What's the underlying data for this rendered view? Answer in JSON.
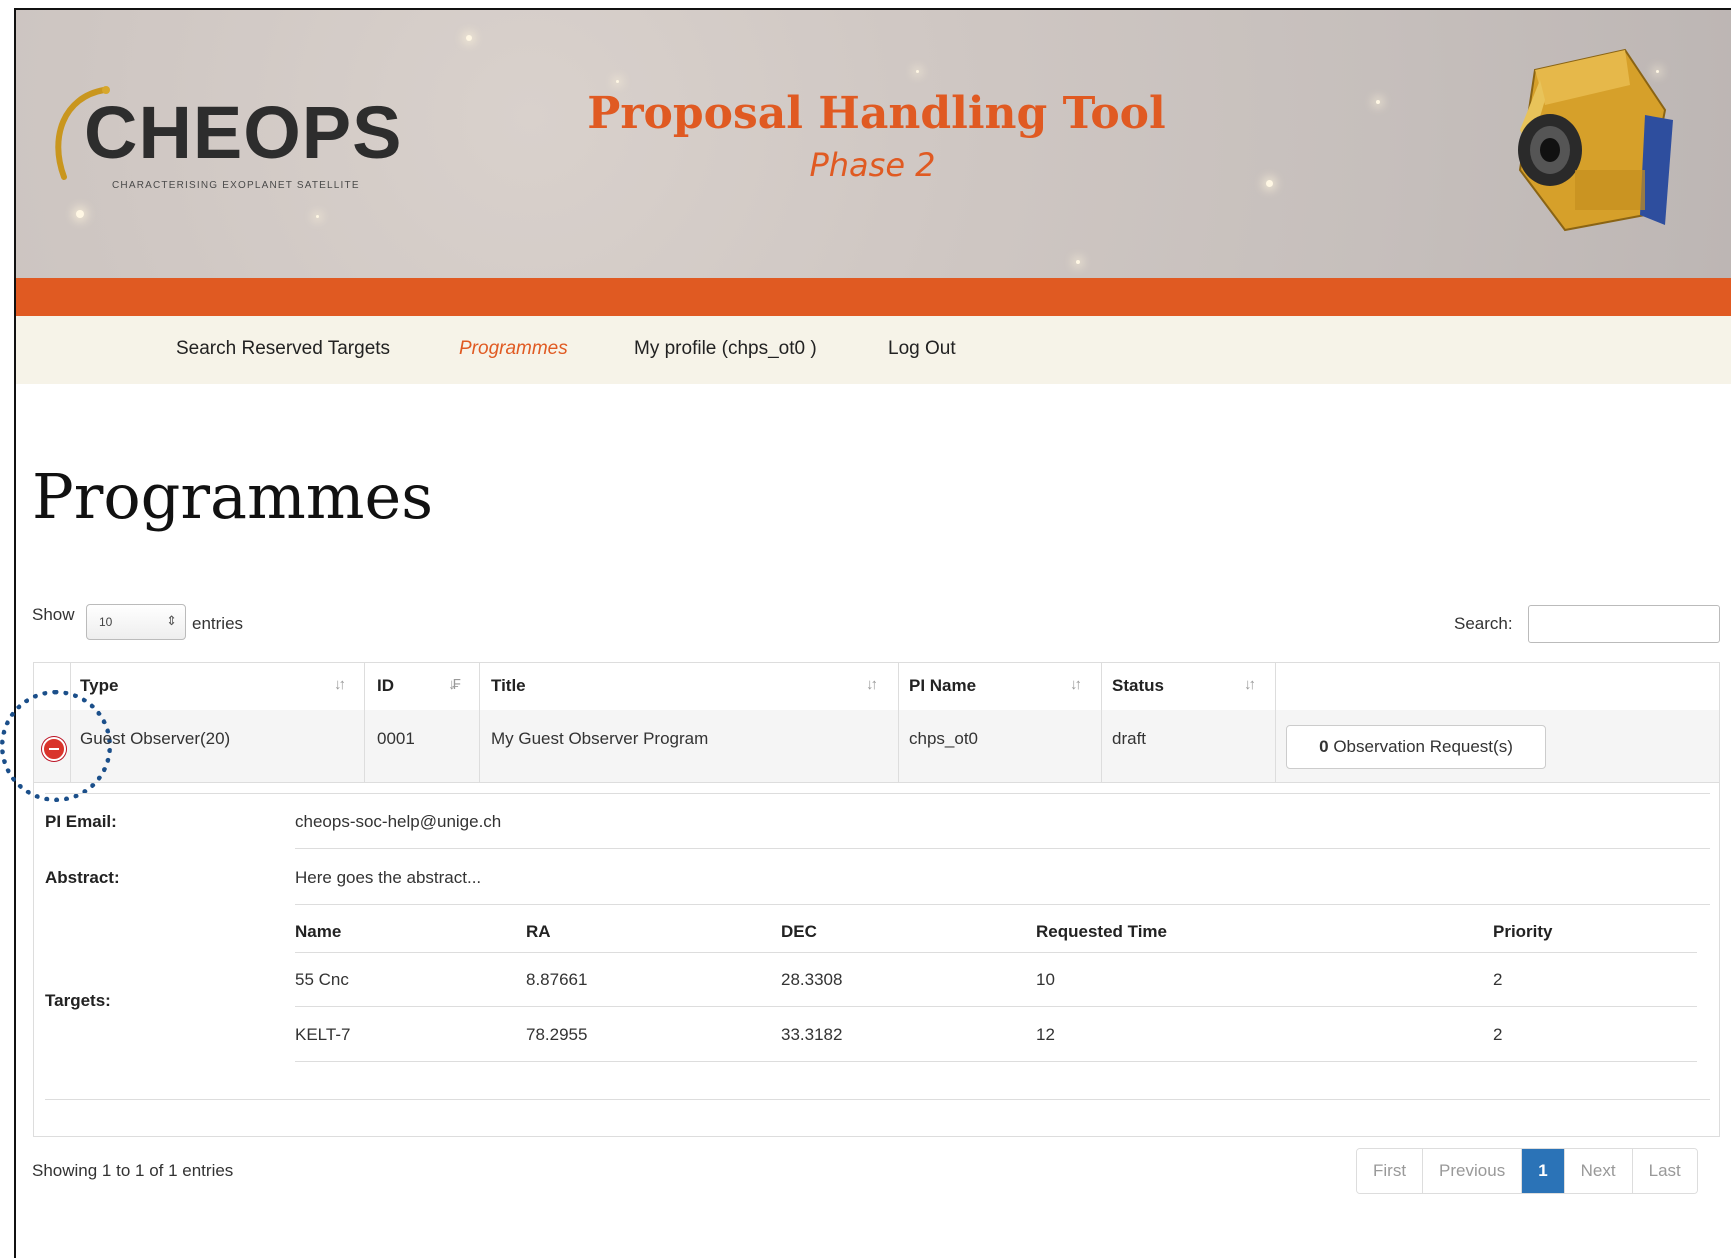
{
  "header": {
    "logo_text": "CHEOPS",
    "logo_subtitle": "CHARACTERISING EXOPLANET SATELLITE",
    "app_title": "Proposal Handling Tool",
    "app_subtitle": "Phase 2",
    "accent_color": "#e05a22"
  },
  "nav": {
    "items": [
      {
        "label": "Search Reserved Targets"
      },
      {
        "label": "Programmes"
      },
      {
        "label": "My profile (chps_ot0 )"
      },
      {
        "label": "Log Out"
      }
    ],
    "active": "Programmes"
  },
  "page": {
    "title": "Programmes"
  },
  "controls": {
    "show_label": "Show",
    "entries_value": "10",
    "entries_label": "entries",
    "search_label": "Search:",
    "search_value": ""
  },
  "table": {
    "columns": [
      "Type",
      "ID",
      "Title",
      "PI Name",
      "Status"
    ],
    "rows": [
      {
        "type": "Guest Observer(20)",
        "id": "0001",
        "title": "My Guest Observer Program",
        "pi_name": "chps_ot0",
        "status": "draft",
        "obs_count": "0",
        "obs_label": "Observation Request(s)"
      }
    ]
  },
  "detail": {
    "pi_email_label": "PI Email:",
    "pi_email": "cheops-soc-help@unige.ch",
    "abstract_label": "Abstract:",
    "abstract": "Here goes the abstract...",
    "targets_label": "Targets:",
    "target_columns": [
      "Name",
      "RA",
      "DEC",
      "Requested Time",
      "Priority"
    ],
    "targets": [
      {
        "name": "55 Cnc",
        "ra": "8.87661",
        "dec": "28.3308",
        "time": "10",
        "priority": "2"
      },
      {
        "name": "KELT-7",
        "ra": "78.2955",
        "dec": "33.3182",
        "time": "12",
        "priority": "2"
      }
    ]
  },
  "footer": {
    "info": "Showing 1 to 1 of 1 entries",
    "pagination": [
      "First",
      "Previous",
      "1",
      "Next",
      "Last"
    ],
    "current_page": "1"
  }
}
